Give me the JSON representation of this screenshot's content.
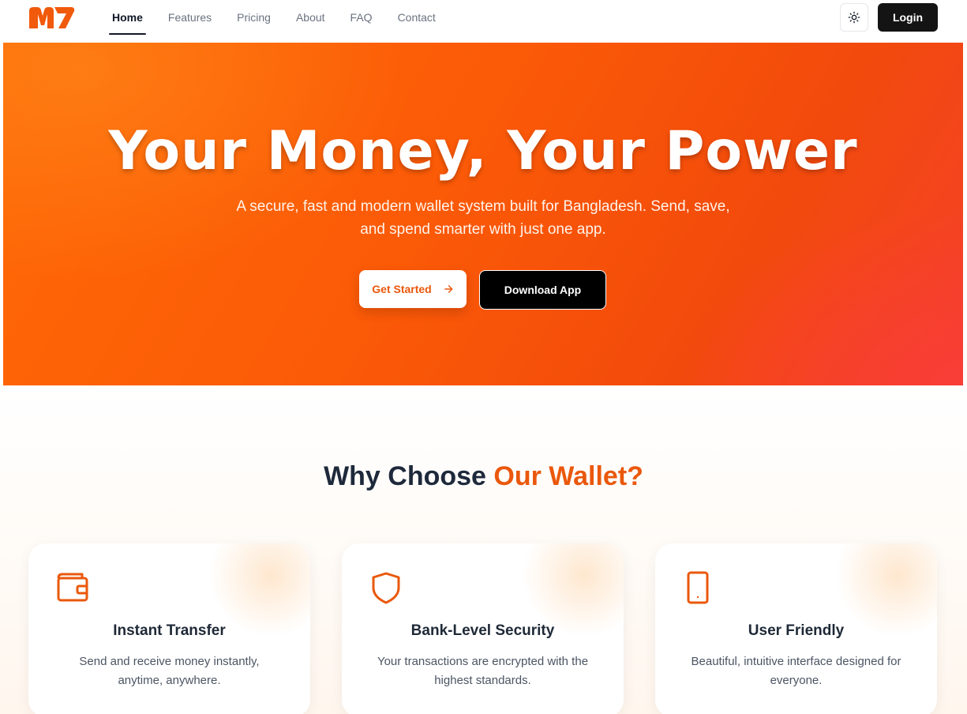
{
  "brand": {
    "logo_text": "M7",
    "accent_color": "#ea580c"
  },
  "nav": {
    "items": [
      {
        "label": "Home",
        "active": true
      },
      {
        "label": "Features"
      },
      {
        "label": "Pricing"
      },
      {
        "label": "About"
      },
      {
        "label": "FAQ"
      },
      {
        "label": "Contact"
      }
    ],
    "theme_toggle_icon": "sun-icon",
    "login_label": "Login"
  },
  "hero": {
    "title": "Your Money, Your Power",
    "subtitle_line1": "A secure, fast and modern wallet system built for Bangladesh. Send, save,",
    "subtitle_line2": "and spend smarter with just one app.",
    "primary_cta": "Get Started",
    "primary_cta_icon": "arrow-right-icon",
    "secondary_cta": "Download App"
  },
  "features": {
    "title_plain": "Why Choose ",
    "title_accent": "Our Wallet?",
    "cards": [
      {
        "icon": "wallet-icon",
        "title": "Instant Transfer",
        "desc_line1": "Send and receive money instantly,",
        "desc_line2": "anytime, anywhere."
      },
      {
        "icon": "shield-icon",
        "title": "Bank-Level Security",
        "desc_line1": "Your transactions are encrypted with the",
        "desc_line2": "highest standards."
      },
      {
        "icon": "smartphone-icon",
        "title": "User Friendly",
        "desc_line1": "Beautiful, intuitive interface designed for",
        "desc_line2": "everyone."
      }
    ]
  }
}
